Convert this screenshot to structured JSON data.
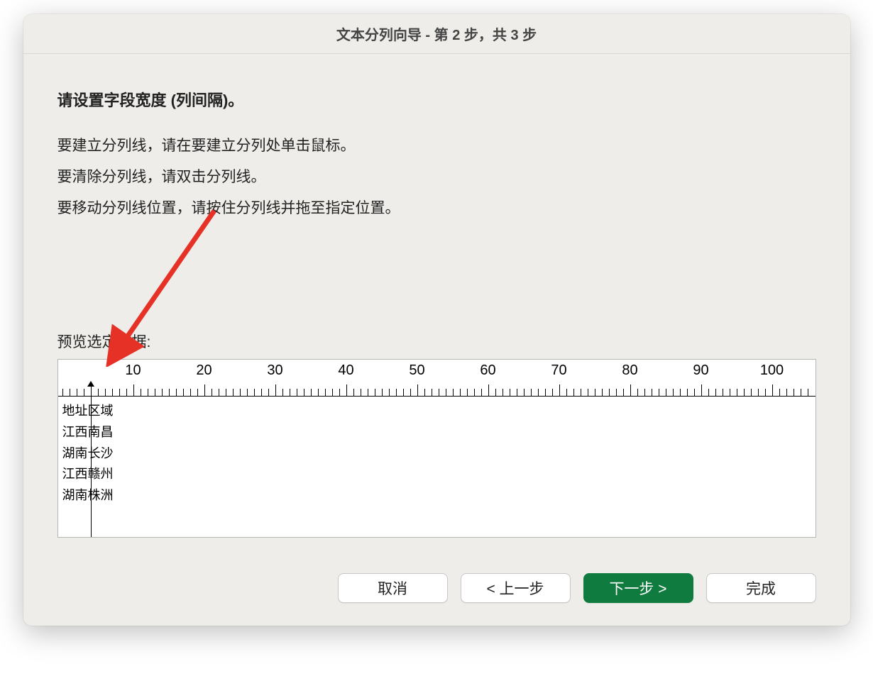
{
  "dialog": {
    "title": "文本分列向导 - 第 2 步，共 3 步",
    "heading": "请设置字段宽度 (列间隔)。",
    "instruction1": "要建立分列线，请在要建立分列处单击鼠标。",
    "instruction2": "要清除分列线，请双击分列线。",
    "instruction3": "要移动分列线位置，请按住分列线并拖至指定位置。",
    "preview_label": "预览选定数据:"
  },
  "ruler": {
    "ticks": [
      10,
      20,
      30,
      40,
      50,
      60,
      70,
      80,
      90,
      100
    ]
  },
  "preview": {
    "break_position_chars": 4,
    "rows": [
      {
        "col1": "地址",
        "col2": "区域"
      },
      {
        "col1": "江西",
        "col2": "南昌"
      },
      {
        "col1": "湖南",
        "col2": "长沙"
      },
      {
        "col1": "江西",
        "col2": "赣州"
      },
      {
        "col1": "湖南",
        "col2": "株洲"
      }
    ]
  },
  "buttons": {
    "cancel": "取消",
    "back": "< 上一步",
    "next": "下一步 >",
    "finish": "完成"
  }
}
